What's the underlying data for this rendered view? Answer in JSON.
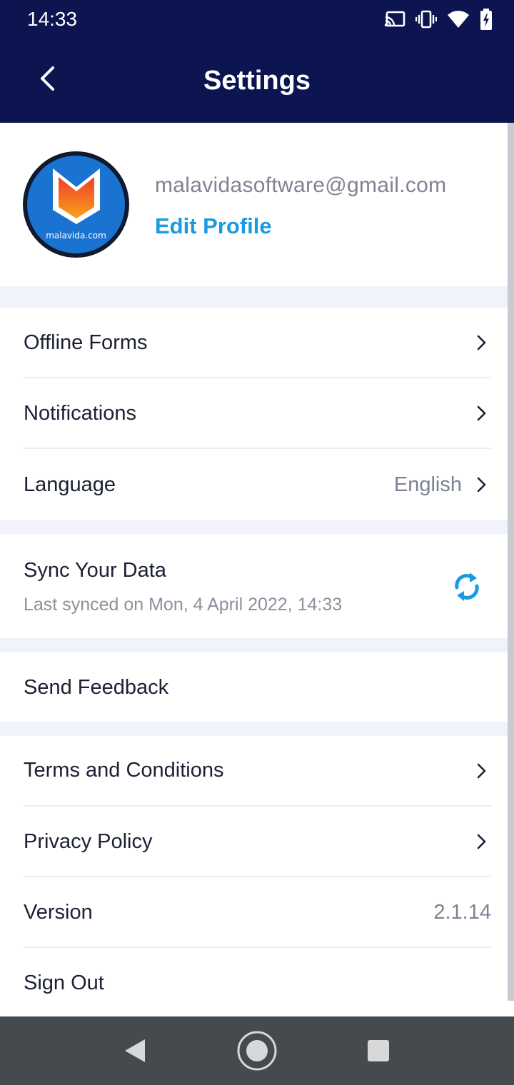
{
  "status_bar": {
    "time": "14:33",
    "icons": [
      "cast-icon",
      "vibrate-icon",
      "wifi-icon",
      "battery-charging-icon"
    ]
  },
  "header": {
    "title": "Settings",
    "back_icon": "chevron-left-icon",
    "background": "#0c1550"
  },
  "profile": {
    "email": "malavidasoftware@gmail.com",
    "edit_label": "Edit Profile",
    "avatar_text": "malavida.com"
  },
  "sections": {
    "offline_forms": "Offline Forms",
    "notifications": "Notifications",
    "language": {
      "label": "Language",
      "value": "English"
    },
    "sync": {
      "label": "Sync Your Data",
      "subtitle": "Last synced on Mon, 4 April 2022, 14:33"
    },
    "send_feedback": "Send Feedback",
    "terms": "Terms and Conditions",
    "privacy": "Privacy Policy",
    "version": {
      "label": "Version",
      "value": "2.1.14"
    },
    "sign_out": "Sign Out"
  },
  "colors": {
    "accent": "#1a9ae0",
    "text_primary": "#1b2033",
    "text_secondary": "#7b8294",
    "section_gap": "#f1f3fb"
  },
  "nav_bar": {
    "icons": [
      "nav-back-icon",
      "nav-home-icon",
      "nav-recents-icon"
    ]
  }
}
